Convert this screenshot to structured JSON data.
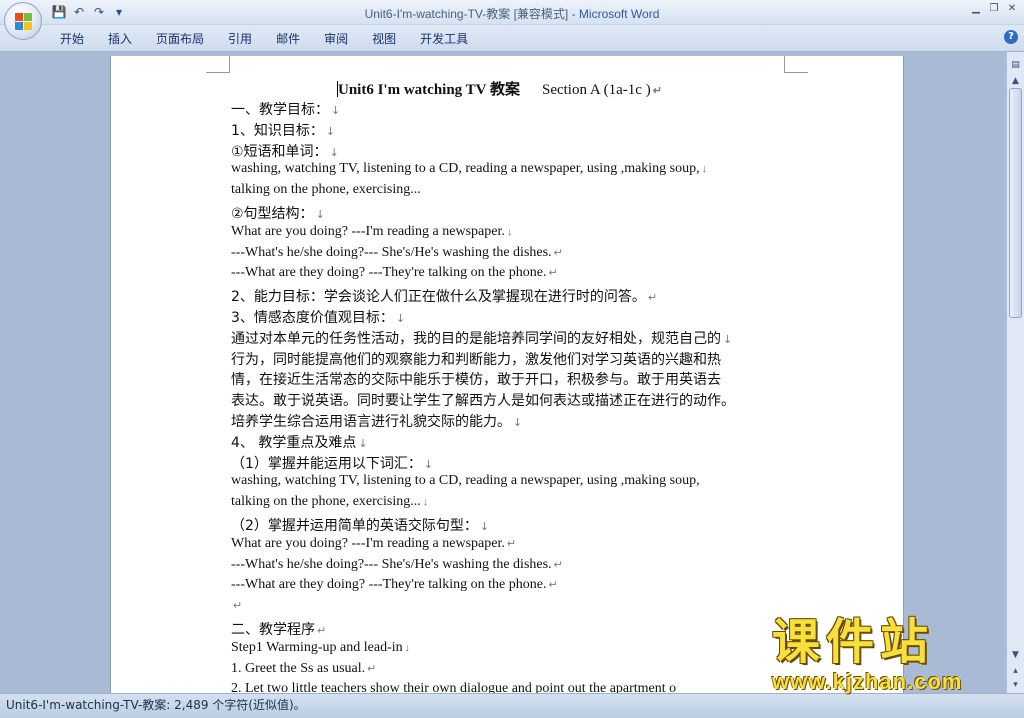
{
  "window": {
    "title": "Unit6-I'm-watching-TV-教案 [兼容模式] - ",
    "app_name": "Microsoft Word",
    "controls": [
      "▁",
      "❐",
      "✕"
    ]
  },
  "quick_access": {
    "save_icon": "💾",
    "undo_icon": "↶",
    "redo_icon": "↷",
    "customize_icon": "▾"
  },
  "ribbon_tabs": [
    "开始",
    "插入",
    "页面布局",
    "引用",
    "邮件",
    "审阅",
    "视图",
    "开发工具"
  ],
  "help": "?",
  "document": {
    "title_main": "Unit6 I'm watching TV  教案",
    "title_section": "Section A (1a-1c )",
    "lines": [
      "一、教学目标：",
      "1、知识目标：",
      "①短语和单词：",
      "washing, watching TV, listening to a CD, reading a newspaper, using ,making soup,",
      "talking on the phone, exercising...",
      "②句型结构：",
      "What are you doing? ---I'm reading a newspaper.",
      "  ---What's he/she doing?--- She's/He's washing the dishes.",
      "---What are they doing?         ---They're talking on the phone.",
      "2、能力目标：学会谈论人们正在做什么及掌握现在进行时的问答。",
      "3、情感态度价值观目标：",
      "通过对本单元的任务性活动，我的目的是能培养同学间的友好相处，规范自己的",
      "行为，同时能提高他们的观察能力和判断能力，激发他们对学习英语的兴趣和热",
      "情，在接近生活常态的交际中能乐于模仿，敢于开口，积极参与。敢于用英语去",
      "表达。敢于说英语。同时要让学生了解西方人是如何表达或描述正在进行的动作。",
      "培养学生综合运用语言进行礼貌交际的能力。",
      "4、 教学重点及难点",
      "（1）掌握并能运用以下词汇：",
      "washing, watching TV, listening to a CD, reading a newspaper, using ,making soup,",
      "talking on the phone, exercising...",
      "（2）掌握并运用简单的英语交际句型：",
      "What are you doing? ---I'm reading a newspaper.",
      "  ---What's he/she doing?--- She's/He's washing the dishes.",
      "---What are they doing?         ---They're talking on the phone.",
      "",
      "二、教学程序",
      "Step1 Warming-up and lead-in",
      "1. Greet the Ss as usual.",
      "2. Let two little teachers show their own dialogue and point out the apartment o"
    ],
    "marks": [
      "↓",
      "↓",
      "↓",
      "↓",
      "",
      "↓",
      "↓",
      "↵",
      "↵",
      "↵",
      "↓",
      "↓",
      "",
      "",
      "",
      "↓",
      "↓",
      "↓",
      "",
      "↓",
      "↓",
      "↵",
      "↵",
      "↵",
      "↵",
      "↵",
      "↓",
      "↵",
      ""
    ]
  },
  "statusbar": {
    "text": "Unit6-I'm-watching-TV-教案: 2,489 个字符(近似值)。"
  },
  "watermark": {
    "cn": "课件站",
    "url": "www.kjzhan.com"
  }
}
